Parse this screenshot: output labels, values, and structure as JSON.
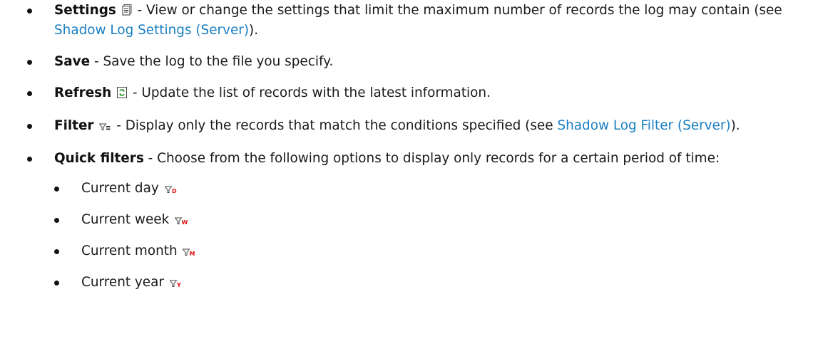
{
  "items": [
    {
      "title": "Settings",
      "icon": "settings-sheet-icon",
      "text_a": " - View or change the settings that limit the maximum number of records the log may contain (see ",
      "link": "Shadow Log Settings (Server)",
      "text_b": ")."
    },
    {
      "title": "Save",
      "text_a": " - Save the log to the file you specify."
    },
    {
      "title": "Refresh",
      "icon": "refresh-icon",
      "text_a": " - Update the list of records with the latest information."
    },
    {
      "title": "Filter",
      "icon": "filter-icon",
      "text_a": " - Display only the records that match the conditions specified (see ",
      "link": "Shadow Log Filter (Server)",
      "text_b": ")."
    },
    {
      "title": "Quick filters",
      "text_a": " - Choose from the following options to display only records for a certain period of time:"
    }
  ],
  "quick_filters": [
    {
      "label": "Current day",
      "icon": "filter-day-icon",
      "letter": "D"
    },
    {
      "label": "Current week",
      "icon": "filter-week-icon",
      "letter": "W"
    },
    {
      "label": "Current month",
      "icon": "filter-month-icon",
      "letter": "M"
    },
    {
      "label": "Current year",
      "icon": "filter-year-icon",
      "letter": "Y"
    }
  ],
  "colors": {
    "link": "#1a7fc1",
    "filter_letter": "#e01010"
  }
}
